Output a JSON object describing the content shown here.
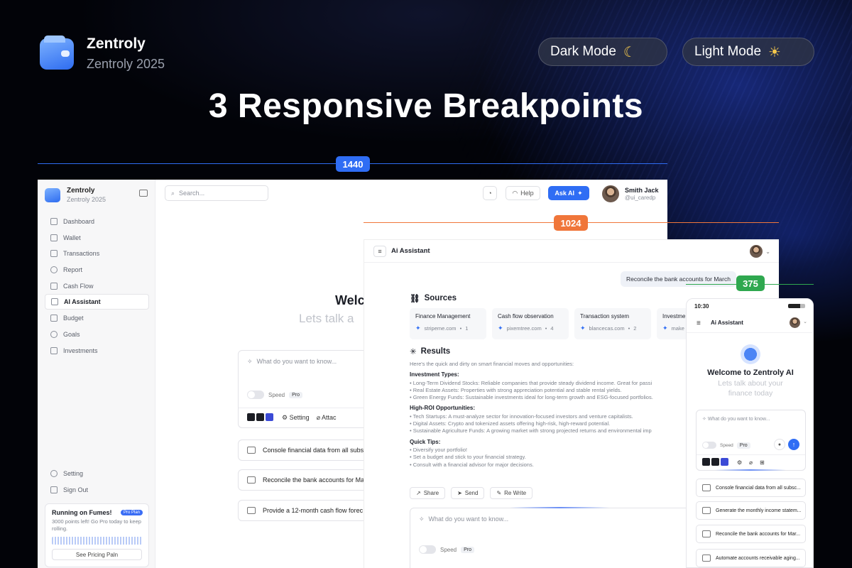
{
  "colors": {
    "accent": "#2f6df4",
    "bp_1440": "#2f6df4",
    "bp_1024": "#f0763a",
    "bp_375": "#2fa84f"
  },
  "brand": {
    "name": "Zentroly",
    "subtitle": "Zentroly 2025"
  },
  "modes": {
    "dark": {
      "label": "Dark Mode",
      "icon": "moon-icon"
    },
    "light": {
      "label": "Light Mode",
      "icon": "sun-cloud-icon"
    }
  },
  "headline": "3 Responsive Breakpoints",
  "breakpoints": {
    "desktop": "1440",
    "tablet": "1024",
    "mobile": "375"
  },
  "desktop": {
    "brand_name": "Zentroly",
    "brand_sub": "Zentroly 2025",
    "nav": [
      {
        "label": "Dashboard",
        "icon": "grid-icon"
      },
      {
        "label": "Wallet",
        "icon": "wallet-icon"
      },
      {
        "label": "Transactions",
        "icon": "card-icon"
      },
      {
        "label": "Report",
        "icon": "pie-icon"
      },
      {
        "label": "Cash Flow",
        "icon": "bar-icon"
      },
      {
        "label": "AI Assistant",
        "icon": "sparkle-icon",
        "active": true
      },
      {
        "label": "Budget",
        "icon": "budget-icon"
      },
      {
        "label": "Goals",
        "icon": "target-icon"
      },
      {
        "label": "Investments",
        "icon": "trend-icon"
      }
    ],
    "bottom_nav": [
      {
        "label": "Setting",
        "icon": "gear-icon"
      },
      {
        "label": "Sign Out",
        "icon": "logout-icon"
      }
    ],
    "promo": {
      "title": "Running on Fumes!",
      "badge": "Pro Plan",
      "text": "3000 points left! Go Pro today to keep rolling.",
      "button": "See Pricing Paln"
    },
    "search_placeholder": "Search...",
    "help": "Help",
    "ask_ai": "Ask AI",
    "user_name": "Smith Jack",
    "user_handle": "@ui_caredp",
    "welcome": "Welco",
    "welcome_sub": "Lets talk a",
    "prompt_placeholder": "What do you want to know...",
    "speed": "Speed",
    "pro": "Pro",
    "setting": "Setting",
    "attach": "Attac",
    "cards": [
      "Console financial data from all subs",
      "Reconcile the bank accounts for Ma",
      "Provide a 12-month cash flow forec"
    ]
  },
  "tablet": {
    "title": "Ai Assistant",
    "bubble": "Reconcile the bank accounts for March",
    "sources_label": "Sources",
    "sources": [
      {
        "title": "Finance Management",
        "site": "stripeme.com",
        "count": "1"
      },
      {
        "title": "Cash flow observation",
        "site": "pixemtree.com",
        "count": "4"
      },
      {
        "title": "Transaction system",
        "site": "blancecas.com",
        "count": "2"
      },
      {
        "title": "Investme",
        "site": "make",
        "count": ""
      }
    ],
    "results_label": "Results",
    "intro": "Here's the quick and dirty on smart financial moves and opportunities:",
    "investment_types": "Investment Types:",
    "inv_items": [
      "Long-Term Dividend Stocks: Reliable companies that provide steady dividend income. Great for passi",
      "Real Estate Assets: Properties with strong appreciation potential and stable rental yields.",
      "Green Energy Funds: Sustainable investments ideal for long-term growth and ESG-focused portfolios."
    ],
    "high_roi": "High-ROI Opportunities:",
    "roi_items": [
      "Tech Startups: A must-analyze sector for innovation-focused investors and venture capitalists.",
      "Digital Assets: Crypto and tokenized assets offering high-risk, high-reward potential.",
      "Sustainable Agriculture Funds: A growing market with strong projected returns and environmental imp"
    ],
    "quick_tips": "Quick Tips:",
    "tip_items": [
      "Diversify your portfolio!",
      "Set a budget and stick to your financial strategy.",
      "Consult with a financial advisor for major decisions."
    ],
    "actions": [
      "Share",
      "Send",
      "Re Write"
    ],
    "prompt_placeholder": "What do you want to know...",
    "speed": "Speed",
    "pro": "Pro"
  },
  "mobile": {
    "time": "10:30",
    "title": "Ai Assistant",
    "welcome": "Welcome to Zentroly AI",
    "sub_line1": "Lets talk about your",
    "sub_line2": "finance today",
    "prompt_placeholder": "What do you want to know...",
    "speed": "Speed",
    "pro": "Pro",
    "cards": [
      "Console financial data from all subsc...",
      "Generate the monthly income statem...",
      "Reconcile the bank accounts for Mar...",
      "Automate accounts receivable aging..."
    ]
  }
}
